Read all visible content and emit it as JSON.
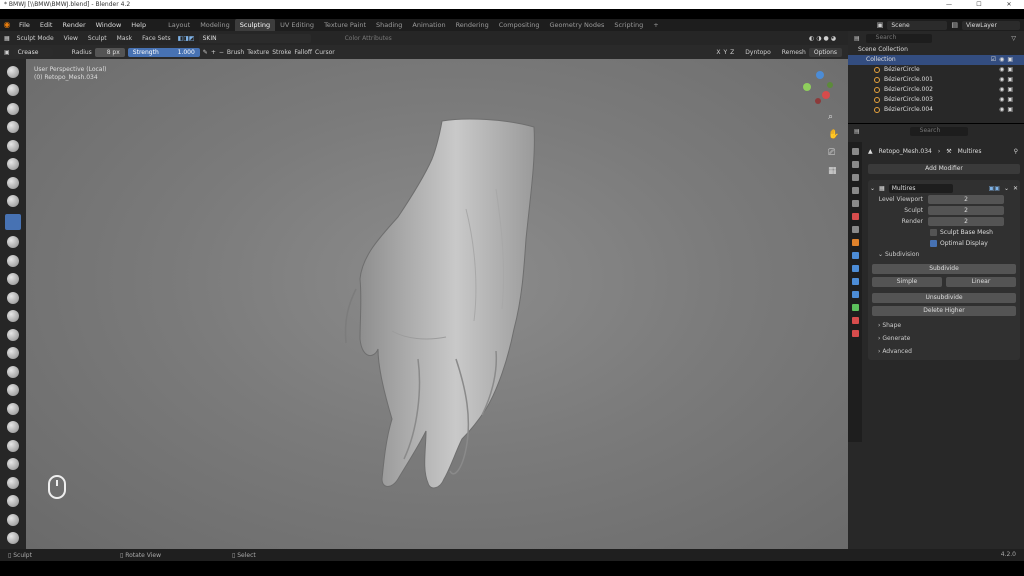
{
  "window": {
    "title": "* BMWJ [\\\\BMW\\BMWJ.blend] - Blender 4.2"
  },
  "menu": {
    "items": [
      "File",
      "Edit",
      "Render",
      "Window",
      "Help"
    ],
    "workspaces": [
      "Layout",
      "Modeling",
      "Sculpting",
      "UV Editing",
      "Texture Paint",
      "Shading",
      "Animation",
      "Rendering",
      "Compositing",
      "Geometry Nodes",
      "Scripting"
    ],
    "active_workspace": "Sculpting",
    "scene": "Scene",
    "viewlayer": "ViewLayer"
  },
  "header": {
    "mode": "Sculpt Mode",
    "items": [
      "View",
      "Sculpt",
      "Mask",
      "Face Sets"
    ],
    "skin": "SKIN",
    "color_attributes": "Color Attributes",
    "dyntopo": "Dyntopo",
    "remesh": "Remesh",
    "options": "Options"
  },
  "toolsettings": {
    "brush": "Crease",
    "radius_label": "Radius",
    "radius_value": "8 px",
    "strength_label": "Strength",
    "strength_value": "1.000",
    "menus": [
      "Brush",
      "Texture",
      "Stroke",
      "Falloff",
      "Cursor"
    ],
    "axes": [
      "X",
      "Y",
      "Z"
    ]
  },
  "viewport": {
    "line1": "User Perspective (Local)",
    "line2": "(0) Retopo_Mesh.034"
  },
  "outliner": {
    "title": "Scene Collection",
    "collection": "Collection",
    "items": [
      "BézierCircle",
      "BézierCircle.001",
      "BézierCircle.002",
      "BézierCircle.003",
      "BézierCircle.004"
    ],
    "search_placeholder": "Search"
  },
  "properties": {
    "object": "Retopo_Mesh.034",
    "modifier_context": "Multires",
    "add_modifier": "Add Modifier",
    "modifier_name": "Multires",
    "rows": [
      {
        "label": "Level Viewport",
        "value": "2"
      },
      {
        "label": "Sculpt",
        "value": "2"
      },
      {
        "label": "Render",
        "value": "2"
      }
    ],
    "sculpt_base_mesh": "Sculpt Base Mesh",
    "optimal_display": "Optimal Display",
    "subdivision": "Subdivision",
    "subdivide": "Subdivide",
    "simple": "Simple",
    "linear": "Linear",
    "unsubdivide": "Unsubdivide",
    "delete_higher": "Delete Higher",
    "sections": [
      "Shape",
      "Generate",
      "Advanced"
    ],
    "search_placeholder": "Search"
  },
  "status": {
    "items": [
      "Sculpt",
      "Rotate View",
      "Select"
    ],
    "version": "4.2.0"
  },
  "colors": {
    "accent": "#4772b3",
    "active_orange": "#e87d0d"
  }
}
